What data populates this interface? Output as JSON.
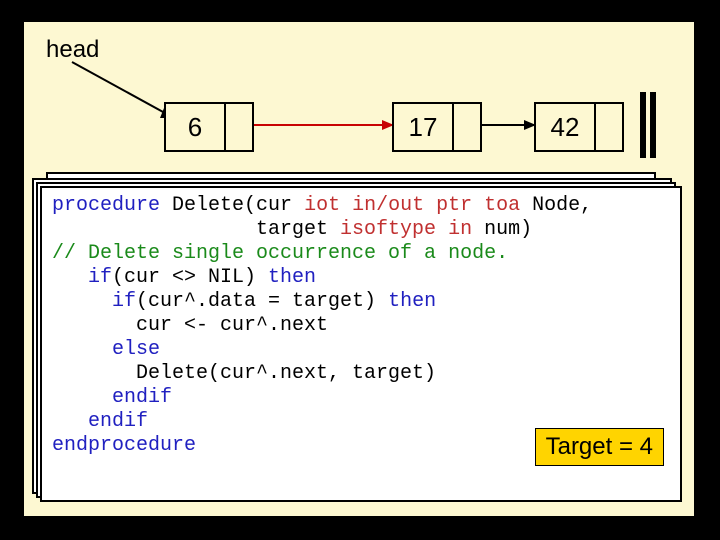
{
  "head_label": "head",
  "nodes": {
    "n1": "6",
    "n2": "17",
    "n3": "42"
  },
  "code": {
    "line1a": "procedure",
    "line1b": " Delete(cur ",
    "line1c": "iot in/out ptr toa",
    "line1d": " Node,",
    "line2a": "                 target ",
    "line2b": "isoftype in",
    "line2c": " num)",
    "line3": "// Delete single occurrence of a node.",
    "line4a": "   if",
    "line4b": "(cur <> NIL) ",
    "line4c": "then",
    "line5a": "     if",
    "line5b": "(cur^.data = target) ",
    "line5c": "then",
    "line6": "       cur <- cur^.next",
    "line7": "     else",
    "line8": "       Delete(cur^.next, target)",
    "line9": "     endif",
    "line10": "   endif",
    "line11": "endprocedure"
  },
  "target_label": "Target = 4"
}
